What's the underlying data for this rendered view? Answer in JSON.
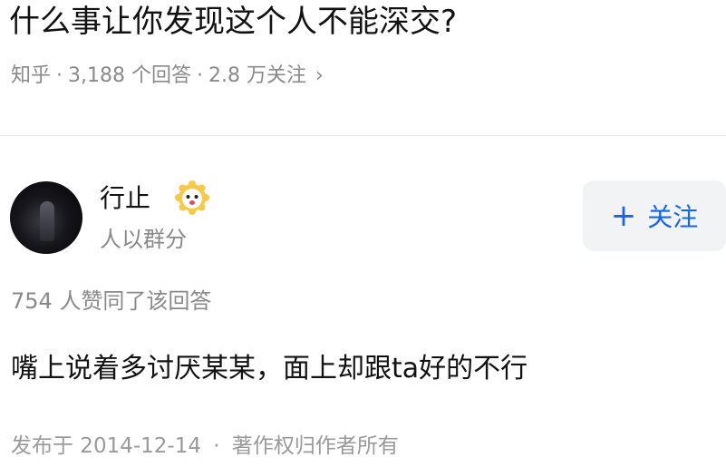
{
  "question": {
    "title": "什么事让你发现这个人不能深交?",
    "source": "知乎",
    "separator": "·",
    "answer_count": "3,188 个回答",
    "follower_count": "2.8 万关注",
    "chevron": "›"
  },
  "author": {
    "name": "行止",
    "bio": "人以群分",
    "avatar_icon": "avatar-photo",
    "badge_icon": "smiley-badge-icon"
  },
  "follow_button": {
    "plus": "+",
    "label": "关注",
    "color": "#1766e8"
  },
  "answer": {
    "likes": "754 人赞同了该回答",
    "content": "嘴上说着多讨厌某某，面上却跟ta好的不行",
    "published": "发布于 2014-12-14",
    "separator": "·",
    "copyright": "著作权归作者所有"
  }
}
